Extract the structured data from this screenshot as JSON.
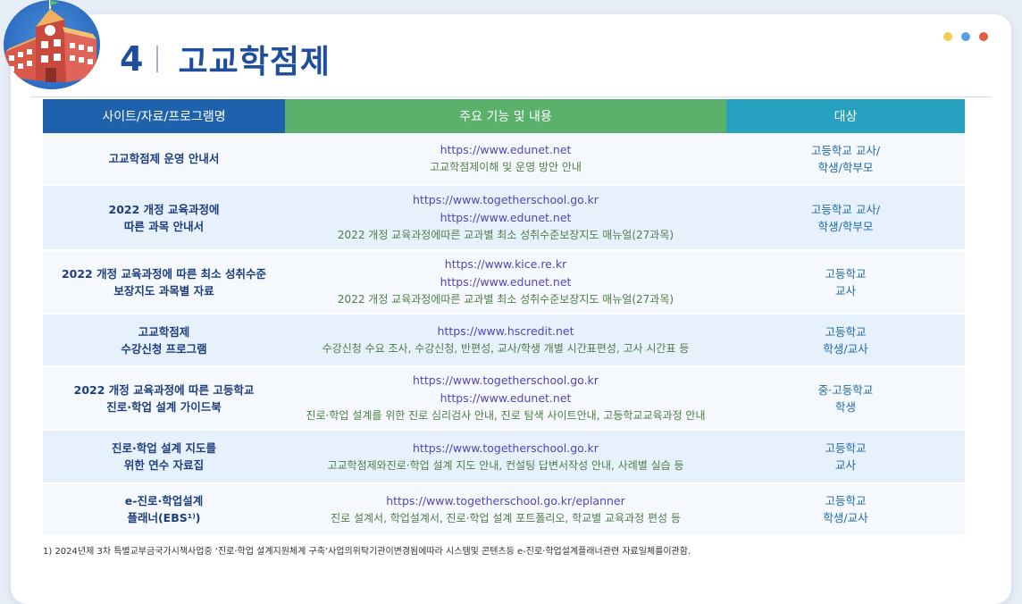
{
  "header": {
    "number": "4",
    "title": "고교학점제"
  },
  "window_dots": [
    "#f1cf54",
    "#5aa0e0",
    "#e45b45"
  ],
  "table": {
    "headers": [
      "사이트/자료/프로그램명",
      "주요 기능 및 내용",
      "대상"
    ],
    "rows": [
      {
        "name": [
          "고교학점제 운영 안내서"
        ],
        "urls": [
          "https://www.edunet.net"
        ],
        "desc": "고교학점제이해 및 운영 방안 안내",
        "target": [
          "고등학교 교사/",
          "학생/학부모"
        ]
      },
      {
        "name": [
          "2022 개정 교육과정에",
          "따른 과목 안내서"
        ],
        "urls": [
          "https://www.togetherschool.go.kr",
          "https://www.edunet.net"
        ],
        "desc": "2022 개정 교육과정에따른 교과별 최소 성취수준보장지도 매뉴얼(27과목)",
        "target": [
          "고등학교 교사/",
          "학생/학부모"
        ]
      },
      {
        "name": [
          "2022 개정 교육과정에 따른 최소 성취수준",
          "보장지도 과목별 자료"
        ],
        "urls": [
          "https://www.kice.re.kr",
          "https://www.edunet.net"
        ],
        "desc": "2022 개정 교육과정에따른 교과별 최소 성취수준보장지도 매뉴얼(27과목)",
        "target": [
          "고등학교",
          "교사"
        ]
      },
      {
        "name": [
          "고교학점제",
          "수강신청 프로그램"
        ],
        "urls": [
          "https://www.hscredit.net"
        ],
        "desc": "수강신청 수요 조사, 수강신청, 반편성, 교사/학생 개별 시간표편성, 고사 시간표 등",
        "target": [
          "고등학교",
          "학생/교사"
        ]
      },
      {
        "name": [
          "2022 개정 교육과정에 따른 고등학교",
          "진로·학업 설계 가이드북"
        ],
        "urls": [
          "https://www.togetherschool.go.kr",
          "https://www.edunet.net"
        ],
        "desc": "진로·학업 설계를 위한 진로 심리검사 안내, 진로 탐색 사이트안내, 고등학교교육과정 안내",
        "target": [
          "중·고등학교",
          "학생"
        ]
      },
      {
        "name": [
          "진로·학업 설계 지도를",
          "위한 연수 자료집"
        ],
        "urls": [
          "https://www.togetherschool.go.kr"
        ],
        "desc": "고교학점제와진로·학업 설계 지도 안내, 컨설팅 답변서작성 안내, 사례별 실습 등",
        "target": [
          "고등학교",
          "교사"
        ]
      },
      {
        "name": [
          "e-진로·학업설계",
          "플래너(EBS¹⁾)"
        ],
        "urls": [
          "https://www.togetherschool.go.kr/eplanner"
        ],
        "desc": "진로 설계서, 학업설계서, 진로·학업 설계 포트폴리오, 학교별 교육과정 편성 등",
        "target": [
          "고등학교",
          "학생/교사"
        ]
      }
    ]
  },
  "footnote": "1) 2024년제 3차 특별교부금국가시책사업중 ‘진로·학업 설계지원체계 구축’사업의위탁기관이변경됨에따라 시스템및 콘텐츠등 e-진로·학업설계플래너관련 자료일체를이관함."
}
